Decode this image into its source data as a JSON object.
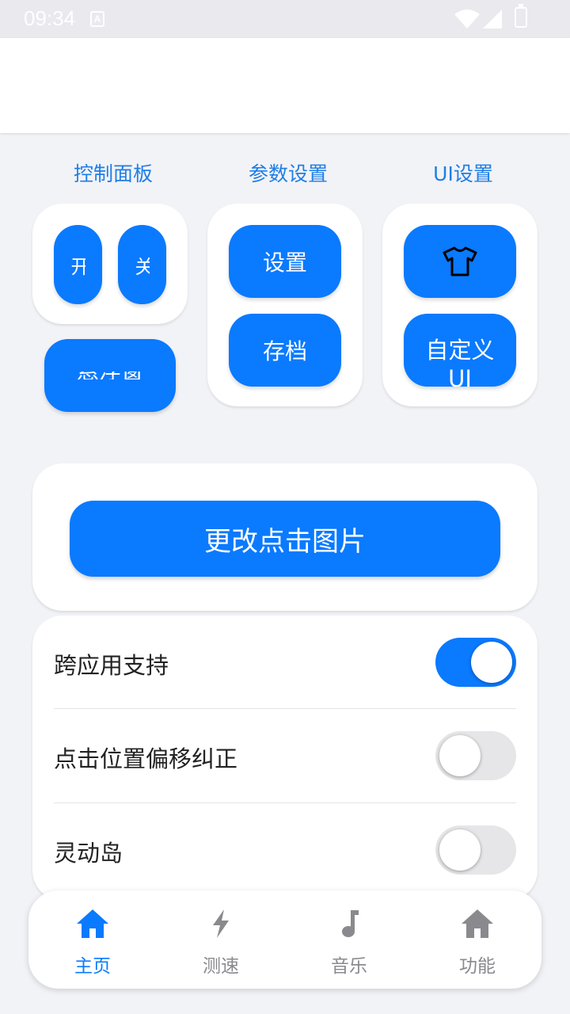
{
  "status_bar": {
    "time": "09:34",
    "a_icon": "A"
  },
  "sections": {
    "control": {
      "title": "控制面板",
      "btn1": "开",
      "btn2": "关",
      "btn3": "悬浮窗"
    },
    "params": {
      "title": "参数设置",
      "settings": "设置",
      "save": "存档"
    },
    "ui": {
      "title": "UI设置",
      "shirt_icon": "shirt-icon",
      "custom": "自定义UI"
    }
  },
  "main_action": {
    "label": "更改点击图片"
  },
  "settings": [
    {
      "label": "跨应用支持",
      "enabled": true
    },
    {
      "label": "点击位置偏移纠正",
      "enabled": false
    },
    {
      "label": "灵动岛",
      "enabled": false
    }
  ],
  "tabs": [
    {
      "label": "主页",
      "icon": "home-icon",
      "active": true
    },
    {
      "label": "测速",
      "icon": "lightning-icon",
      "active": false
    },
    {
      "label": "音乐",
      "icon": "music-note-icon",
      "active": false
    },
    {
      "label": "功能",
      "icon": "home-icon",
      "active": false
    }
  ],
  "colors": {
    "accent": "#0a7aff",
    "section_title": "#1f7ee6",
    "background": "#f2f3f7"
  }
}
